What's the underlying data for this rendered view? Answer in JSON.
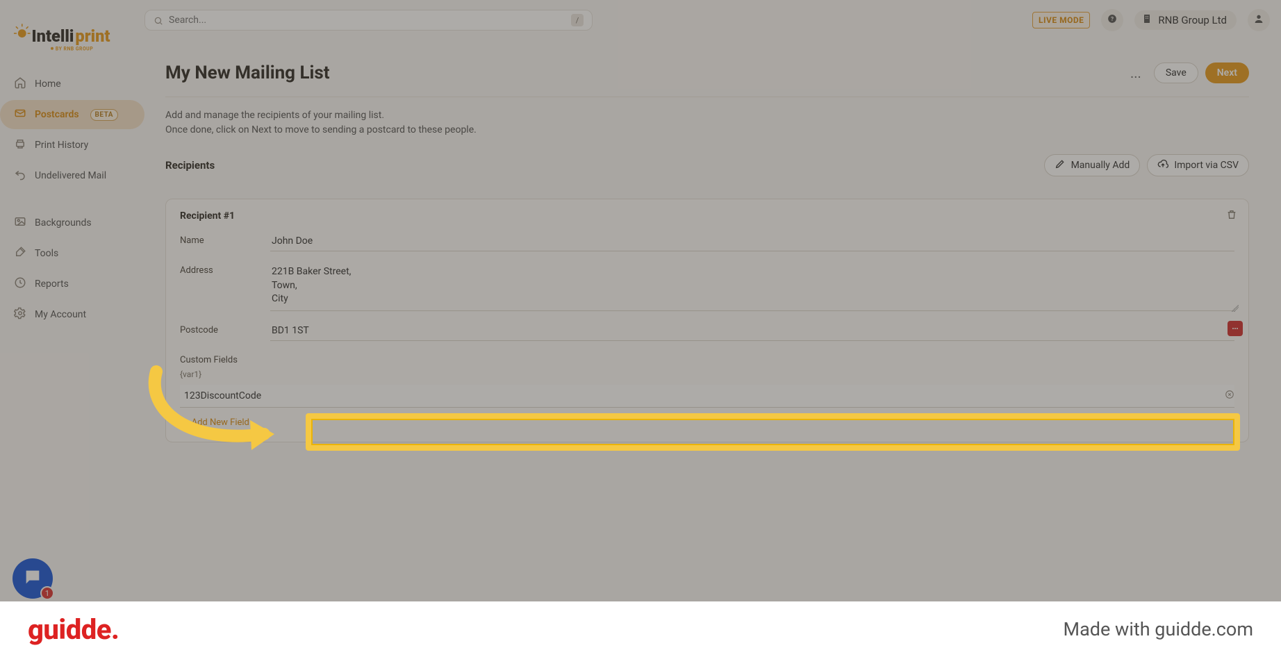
{
  "topbar": {
    "search_placeholder": "Search...",
    "slash_hint": "/",
    "live_mode": "LIVE MODE",
    "org_name": "RNB Group Ltd"
  },
  "logo": {
    "primary": "Intelliprint",
    "sub": "BY RNB GROUP"
  },
  "sidebar": [
    {
      "label": "Home",
      "icon": "home-icon"
    },
    {
      "label": "Postcards",
      "icon": "postcard-icon",
      "badge": "BETA",
      "active": true
    },
    {
      "label": "Print History",
      "icon": "history-icon"
    },
    {
      "label": "Undelivered Mail",
      "icon": "return-icon"
    }
  ],
  "sidebar2": [
    {
      "label": "Backgrounds",
      "icon": "image-icon"
    },
    {
      "label": "Tools",
      "icon": "tools-icon"
    },
    {
      "label": "Reports",
      "icon": "clock-icon"
    },
    {
      "label": "My Account",
      "icon": "gear-icon"
    }
  ],
  "page": {
    "title": "My New Mailing List",
    "intro_line1": "Add and manage the recipients of your mailing list.",
    "intro_line2": "Once done, click on Next to move to sending a postcard to these people.",
    "recipients_label": "Recipients",
    "manually_add": "Manually Add",
    "import_csv": "Import via CSV",
    "more": "...",
    "save": "Save",
    "next": "Next"
  },
  "recipient": {
    "heading": "Recipient #1",
    "name_label": "Name",
    "name_value": "John Doe",
    "address_label": "Address",
    "address_value": "221B Baker Street,\nTown,\nCity",
    "postcode_label": "Postcode",
    "postcode_value": "BD1 1ST",
    "custom_fields_label": "Custom Fields",
    "var_label": "{var1}",
    "custom_field_value": "123DiscountCode",
    "add_new_field": "+ Add New Field"
  },
  "chat": {
    "badge": "1"
  },
  "footer": {
    "brand": "guidde",
    "made_with": "Made with guidde.com"
  }
}
